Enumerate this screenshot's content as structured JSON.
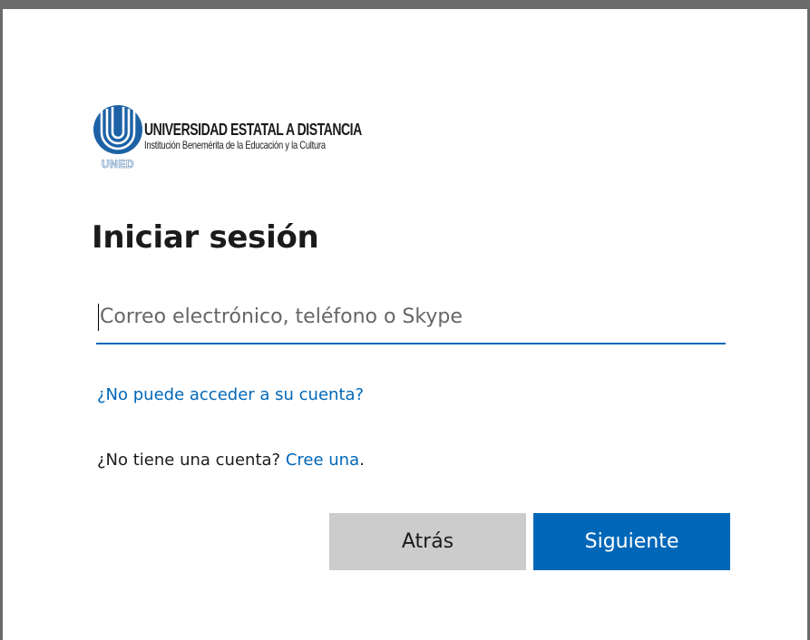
{
  "logo": {
    "title": "UNIVERSIDAD ESTATAL A DISTANCIA",
    "subtitle": "Institución Benemérita de la Educación y la Cultura",
    "mark": "UNED",
    "brand_color": "#1d62a6"
  },
  "page": {
    "title": "Iniciar sesión"
  },
  "login": {
    "placeholder": "Correo electrónico, teléfono o Skype",
    "value": ""
  },
  "links": {
    "forgot": "¿No puede acceder a su cuenta?",
    "no_account_prefix": "¿No tiene una cuenta?",
    "create": "Cree una",
    "suffix": "."
  },
  "buttons": {
    "back": "Atrás",
    "next": "Siguiente"
  },
  "colors": {
    "accent": "#0067b8",
    "secondary_button": "#cccccc",
    "frame": "#6b6b6b"
  }
}
